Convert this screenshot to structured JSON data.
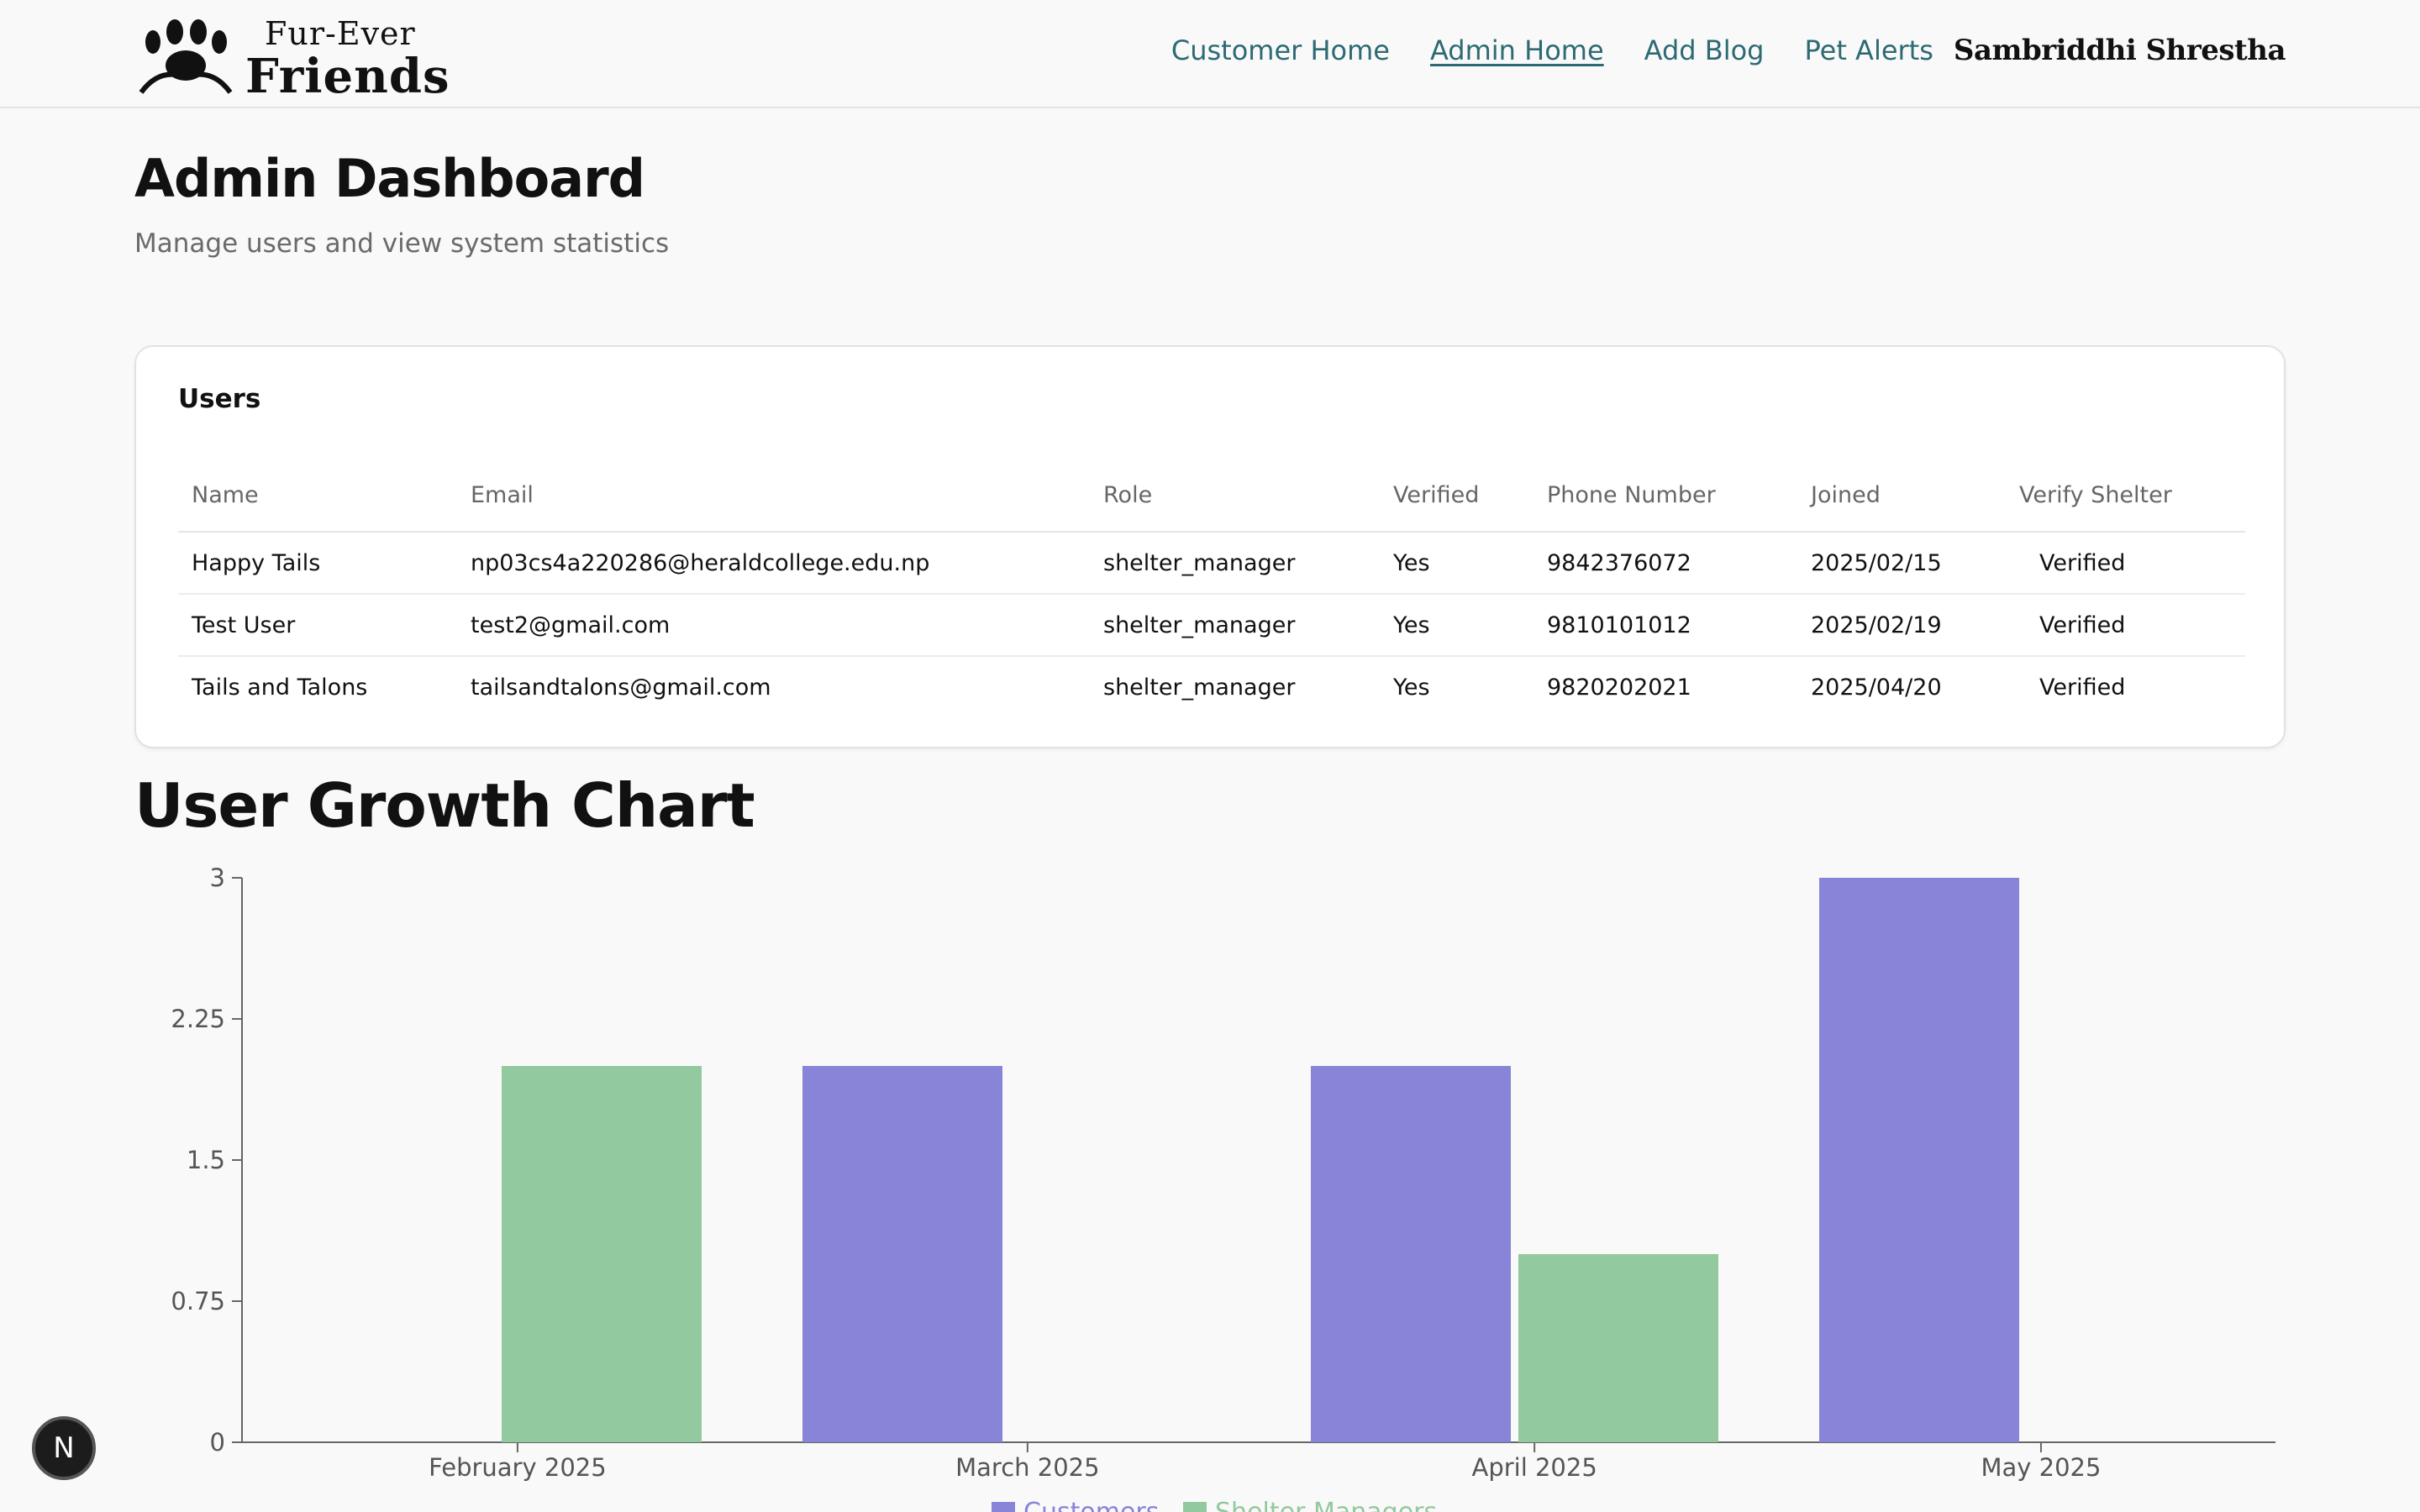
{
  "header": {
    "logo_line1": "Fur-Ever",
    "logo_line2": "Friends",
    "nav": [
      "Customer Home",
      "Admin Home",
      "Add Blog",
      "Pet Alerts"
    ],
    "active_nav": "Admin Home",
    "user_name": "Sambriddhi Shrestha"
  },
  "page": {
    "title": "Admin Dashboard",
    "subtitle": "Manage users and view system statistics"
  },
  "users": {
    "title": "Users",
    "columns": [
      "Name",
      "Email",
      "Role",
      "Verified",
      "Phone Number",
      "Joined",
      "Verify Shelter"
    ],
    "rows": [
      [
        "Happy Tails",
        "np03cs4a220286@heraldcollege.edu.np",
        "shelter_manager",
        "Yes",
        "9842376072",
        "2025/02/15",
        "Verified"
      ],
      [
        "Test User",
        "test2@gmail.com",
        "shelter_manager",
        "Yes",
        "9810101012",
        "2025/02/19",
        "Verified"
      ],
      [
        "Tails and Talons",
        "tailsandtalons@gmail.com",
        "shelter_manager",
        "Yes",
        "9820202021",
        "2025/04/20",
        "Verified"
      ]
    ]
  },
  "chart_section": {
    "title": "User Growth Chart"
  },
  "chart_data": {
    "type": "bar",
    "categories": [
      "February 2025",
      "March 2025",
      "April 2025",
      "May 2025"
    ],
    "series": [
      {
        "name": "Customers",
        "values": [
          0,
          2,
          2,
          3
        ],
        "color": "#8884d8"
      },
      {
        "name": "Shelter Managers",
        "values": [
          2,
          0,
          1,
          0
        ],
        "color": "#93c99e"
      }
    ],
    "y_ticks": [
      0,
      0.75,
      1.5,
      2.25,
      3
    ],
    "y_tick_labels": [
      "0",
      "0.75",
      "1.5",
      "2.25",
      "3"
    ],
    "ylim": [
      0,
      3
    ],
    "legend_position": "bottom",
    "grid": false
  },
  "badge": {
    "label": "N"
  },
  "colors": {
    "nav_link": "#2d6a73",
    "customers": "#8884d8",
    "shelter_managers": "#93c99e"
  },
  "icons": [
    "paw-logo-icon"
  ]
}
